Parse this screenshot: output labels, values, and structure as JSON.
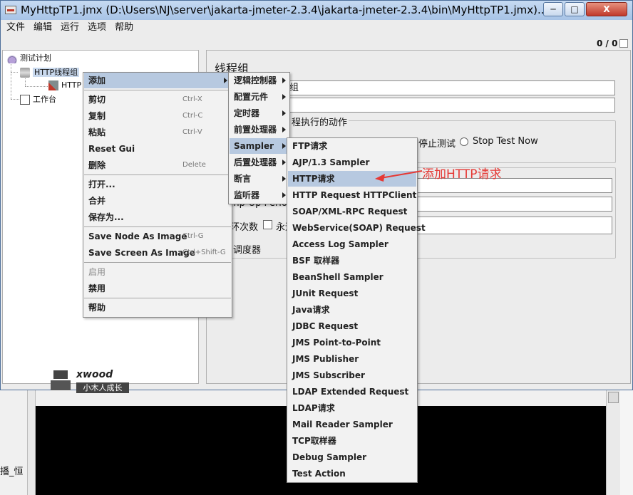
{
  "window": {
    "title": "MyHttpTP1.jmx (D:\\Users\\NJ\\server\\jakarta-jmeter-2.3.4\\jakarta-jmeter-2.3.4\\bin\\MyHttpTP1.jmx)...",
    "minimize": "─",
    "maximize": "□",
    "close": "X"
  },
  "menubar": [
    "文件",
    "编辑",
    "运行",
    "选项",
    "帮助"
  ],
  "toolbar": {
    "counter": "0 / 0"
  },
  "tree": {
    "test_plan": "测试计划",
    "thread_group": "HTTP线程组",
    "http_child": "HTTP",
    "workbench": "工作台"
  },
  "panel": {
    "title": "线程组",
    "name_value": "组",
    "action_label": "程执行的动作",
    "stop_test": "停止测试",
    "stop_test_now": "Stop Test Now",
    "rampup_label": "mp-Up Period",
    "loop_label": "环次数",
    "forever_label": "永远",
    "scheduler_label": "调度器"
  },
  "watermark": {
    "brand": "xwood",
    "sub": "小木人成长"
  },
  "context_menu": {
    "add": "添加",
    "cut": "剪切",
    "cut_sc": "Ctrl-X",
    "copy": "复制",
    "copy_sc": "Ctrl-C",
    "paste": "粘贴",
    "paste_sc": "Ctrl-V",
    "reset_gui": "Reset Gui",
    "delete": "删除",
    "delete_sc": "Delete",
    "open": "打开...",
    "merge": "合并",
    "save_as": "保存为...",
    "save_node_image": "Save Node As Image",
    "save_node_sc": "Ctrl-G",
    "save_screen_image": "Save Screen As Image",
    "save_screen_sc": "Ctrl+Shift-G",
    "enable": "启用",
    "disable": "禁用",
    "help": "帮助"
  },
  "add_submenu": [
    "逻辑控制器",
    "配置元件",
    "定时器",
    "前置处理器",
    "Sampler",
    "后置处理器",
    "断言",
    "监听器"
  ],
  "sampler_submenu": [
    "FTP请求",
    "AJP/1.3 Sampler",
    "HTTP请求",
    "HTTP Request HTTPClient",
    "SOAP/XML-RPC Request",
    "WebService(SOAP) Request",
    "Access Log Sampler",
    "BSF 取样器",
    "BeanShell Sampler",
    "JUnit Request",
    "Java请求",
    "JDBC Request",
    "JMS Point-to-Point",
    "JMS Publisher",
    "JMS Subscriber",
    "LDAP Extended Request",
    "LDAP请求",
    "Mail Reader Sampler",
    "TCP取样器",
    "Debug Sampler",
    "Test Action"
  ],
  "annotation": "添加HTTP请求",
  "background": {
    "fragment": "播_恒"
  }
}
